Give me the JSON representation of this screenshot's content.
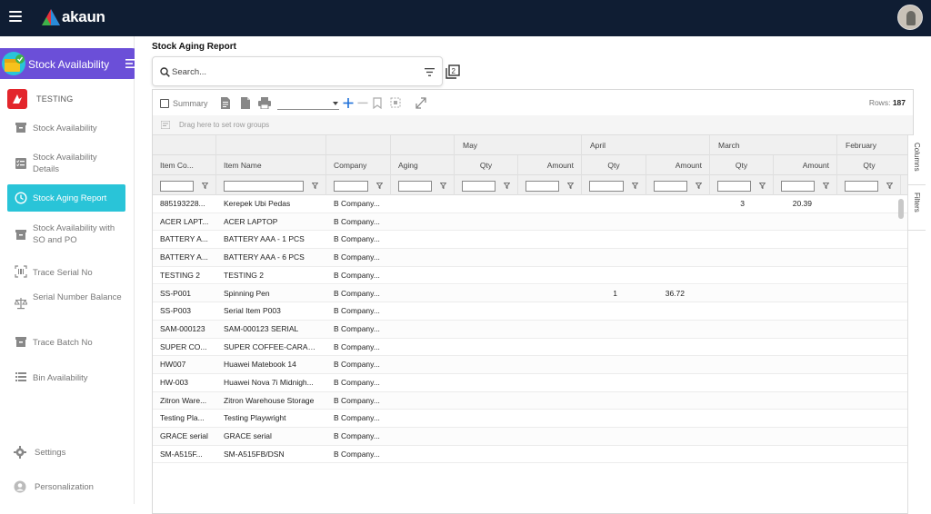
{
  "app": {
    "brand": "akaun",
    "module_title": "Stock Availability",
    "org_name": "TESTING"
  },
  "nav": [
    {
      "label": "Stock Availability",
      "icon": "box-icon",
      "active": false
    },
    {
      "label": "Stock Availability Details",
      "icon": "checklist-icon",
      "active": false
    },
    {
      "label": "Stock Aging Report",
      "icon": "clock-icon",
      "active": true
    },
    {
      "label": "Stock Availability with SO and PO",
      "icon": "box-icon",
      "active": false
    },
    {
      "label": "Trace Serial No",
      "icon": "barcode-icon",
      "active": false
    },
    {
      "label": "Serial Number Balance",
      "icon": "scale-icon",
      "active": false
    },
    {
      "label": "Trace Batch No",
      "icon": "box-icon",
      "active": false
    },
    {
      "label": "Bin Availability",
      "icon": "list-icon",
      "active": false
    }
  ],
  "footer": {
    "settings": "Settings",
    "personalization": "Personalization"
  },
  "page": {
    "title": "Stock Aging Report",
    "search_placeholder": "Search..."
  },
  "toolbar": {
    "summary_label": "Summary",
    "rows_label": "Rows:",
    "rows_count": "187",
    "group_hint": "Drag here to set row groups"
  },
  "columns": {
    "group_headers": [
      "May",
      "April",
      "March",
      "February"
    ],
    "fixed": [
      "Item Co...",
      "Item Name",
      "Company",
      "Aging"
    ],
    "qty": "Qty",
    "amount": "Amount"
  },
  "rows": [
    {
      "code": "885193228...",
      "name": "Kerepek Ubi Pedas",
      "company": "B Company...",
      "mar_qty": "3",
      "mar_amount": "20.39"
    },
    {
      "code": "ACER LAPT...",
      "name": "ACER LAPTOP",
      "company": "B Company..."
    },
    {
      "code": "BATTERY A...",
      "name": "BATTERY AAA - 1 PCS",
      "company": "B Company..."
    },
    {
      "code": "BATTERY A...",
      "name": "BATTERY AAA - 6 PCS",
      "company": "B Company..."
    },
    {
      "code": "TESTING 2",
      "name": "TESTING 2",
      "company": "B Company..."
    },
    {
      "code": "SS-P001",
      "name": "Spinning Pen",
      "company": "B Company...",
      "apr_qty": "1",
      "apr_amount": "36.72"
    },
    {
      "code": "SS-P003",
      "name": "Serial Item P003",
      "company": "B Company..."
    },
    {
      "code": "SAM-000123",
      "name": "SAM-000123 SERIAL",
      "company": "B Company..."
    },
    {
      "code": "SUPER CO...",
      "name": "SUPER COFFEE-CARAM...",
      "company": "B Company..."
    },
    {
      "code": "HW007",
      "name": "Huawei Matebook 14",
      "company": "B Company..."
    },
    {
      "code": "HW-003",
      "name": "Huawei Nova 7i Midnigh...",
      "company": "B Company..."
    },
    {
      "code": "Zitron Ware...",
      "name": "Zitron Warehouse Storage",
      "company": "B Company..."
    },
    {
      "code": "Testing Pla...",
      "name": "Testing Playwright",
      "company": "B Company..."
    },
    {
      "code": "GRACE serial",
      "name": "GRACE serial",
      "company": "B Company..."
    },
    {
      "code": "SM-A515F...",
      "name": "SM-A515FB/DSN",
      "company": "B Company..."
    }
  ],
  "side_tabs": [
    "Columns",
    "Filters"
  ],
  "colors": {
    "topbar": "#0f1d33",
    "module_bar": "#6b4fd8",
    "active_nav": "#29c4d8",
    "accent_blue": "#1e6fd9"
  }
}
